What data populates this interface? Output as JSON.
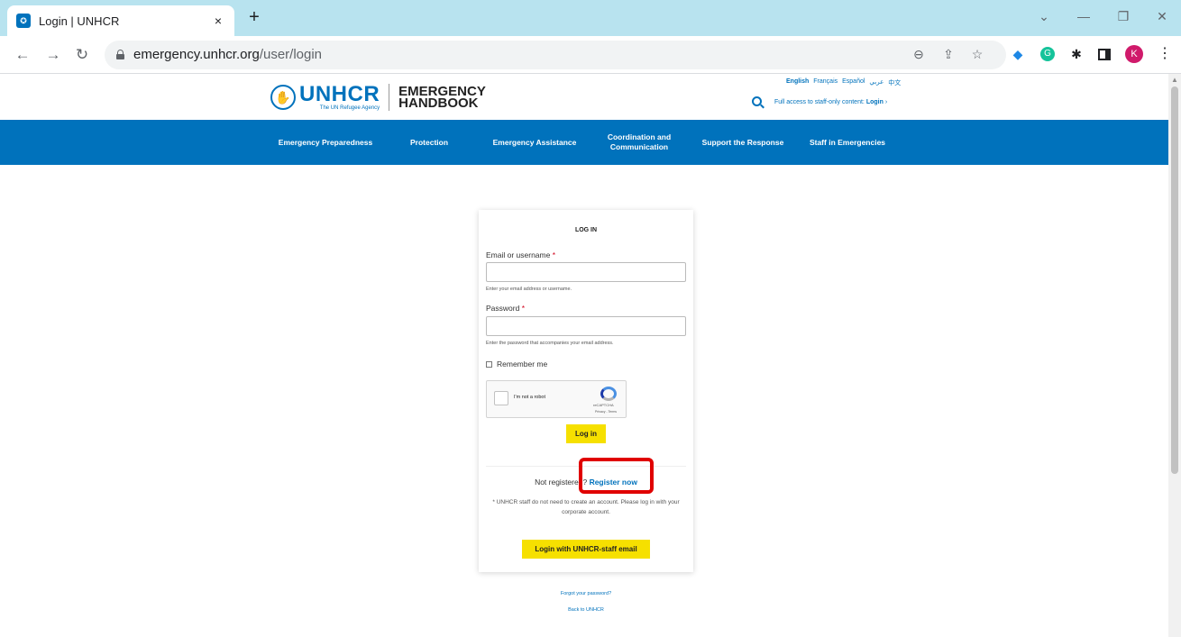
{
  "browser": {
    "tab_title": "Login | UNHCR",
    "tab_close": "×",
    "new_tab": "+",
    "url_domain": "emergency.unhcr.org",
    "url_path": "/user/login",
    "profile_initial": "K",
    "icons": [
      "back-icon",
      "forward-icon",
      "reload-icon",
      "lock-icon",
      "zoom-icon",
      "share-icon",
      "bookmark-star-icon",
      "extension-icon",
      "grammarly-icon",
      "puzzle-icon",
      "sidebar-icon",
      "menu-icon"
    ]
  },
  "header": {
    "logo_main": "UNHCR",
    "logo_sub": "The UN Refugee Agency",
    "handbook_line1": "EMERGENCY",
    "handbook_line2": "HANDBOOK",
    "languages": [
      "English",
      "Français",
      "Español",
      "عربي",
      "中文"
    ],
    "staff_note": "Full access to staff-only content:",
    "staff_login": "Login",
    "staff_arrow": "›"
  },
  "nav": {
    "items": [
      "Emergency Preparedness",
      "Protection",
      "Emergency Assistance",
      "Coordination and Communication",
      "Support the Response",
      "Staff in Emergencies"
    ]
  },
  "login": {
    "title": "LOG IN",
    "email_label": "Email or username",
    "email_hint": "Enter your email address or username.",
    "password_label": "Password",
    "password_hint": "Enter the password that accompanies your email address.",
    "remember_label": "Remember me",
    "recaptcha_label": "I'm not a robot",
    "recaptcha_brand": "reCAPTCHA",
    "recaptcha_terms": "Privacy - Terms",
    "login_button": "Log in",
    "not_registered": "Not registered?",
    "register_link": "Register now",
    "staff_info": "* UNHCR staff do not need to create an account. Please log in with your corporate account.",
    "staff_button": "Login with UNHCR-staff email"
  },
  "footer": {
    "forgot": "Forgot your password?",
    "back": "Back to UNHCR"
  }
}
